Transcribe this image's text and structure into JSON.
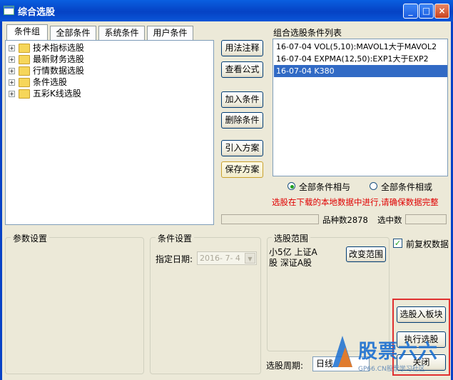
{
  "window": {
    "title": "综合选股",
    "minimize": "_",
    "maximize": "□",
    "close": "×"
  },
  "tabs": [
    {
      "label": "条件组"
    },
    {
      "label": "全部条件"
    },
    {
      "label": "系统条件"
    },
    {
      "label": "用户条件"
    }
  ],
  "tree": {
    "expand_glyph": "+",
    "items": [
      {
        "label": "技术指标选股"
      },
      {
        "label": "最新财务选股"
      },
      {
        "label": "行情数据选股"
      },
      {
        "label": "条件选股"
      },
      {
        "label": "五彩K线选股"
      }
    ]
  },
  "actions": {
    "usage_notes": "用法注释",
    "view_formula": "查看公式",
    "add_condition": "加入条件",
    "delete_condition": "删除条件",
    "import_plan": "引入方案",
    "save_plan": "保存方案"
  },
  "condition_list": {
    "title": "组合选股条件列表",
    "items": [
      {
        "text": "16-07-04 VOL(5,10):MAVOL1大于MAVOL2"
      },
      {
        "text": "16-07-04 EXPMA(12,50):EXP1大于EXP2"
      },
      {
        "text": "16-07-04 K380"
      }
    ]
  },
  "logic": {
    "and_label": "全部条件相与",
    "or_label": "全部条件相或"
  },
  "warning": "选股在下载的本地数据中进行,请确保数据完整",
  "stats": {
    "variety_count": "品种数2878",
    "selected_label": "选中数"
  },
  "params": {
    "title": "参数设置"
  },
  "condition_settings": {
    "title": "条件设置",
    "date_label": "指定日期:",
    "date_value": "2016- 7- 4"
  },
  "scope": {
    "title": "选股范围",
    "text": "小5亿 上证A股 深证A股",
    "change_button": "改变范围"
  },
  "adjusted": {
    "label": "前复权数据",
    "check_glyph": "✓"
  },
  "bottom": {
    "to_sector": "选股入板块",
    "execute": "执行选股",
    "close": "关闭",
    "period_label": "选股周期:",
    "period_value": "日线"
  },
  "watermark": {
    "brand": "股票六六",
    "url": "GP66.CN股票学习社区"
  },
  "colors": {
    "selection": "#316ac5",
    "warning_text": "#e00000",
    "highlight_border": "#e03030",
    "titlebar": "#0542c4"
  }
}
